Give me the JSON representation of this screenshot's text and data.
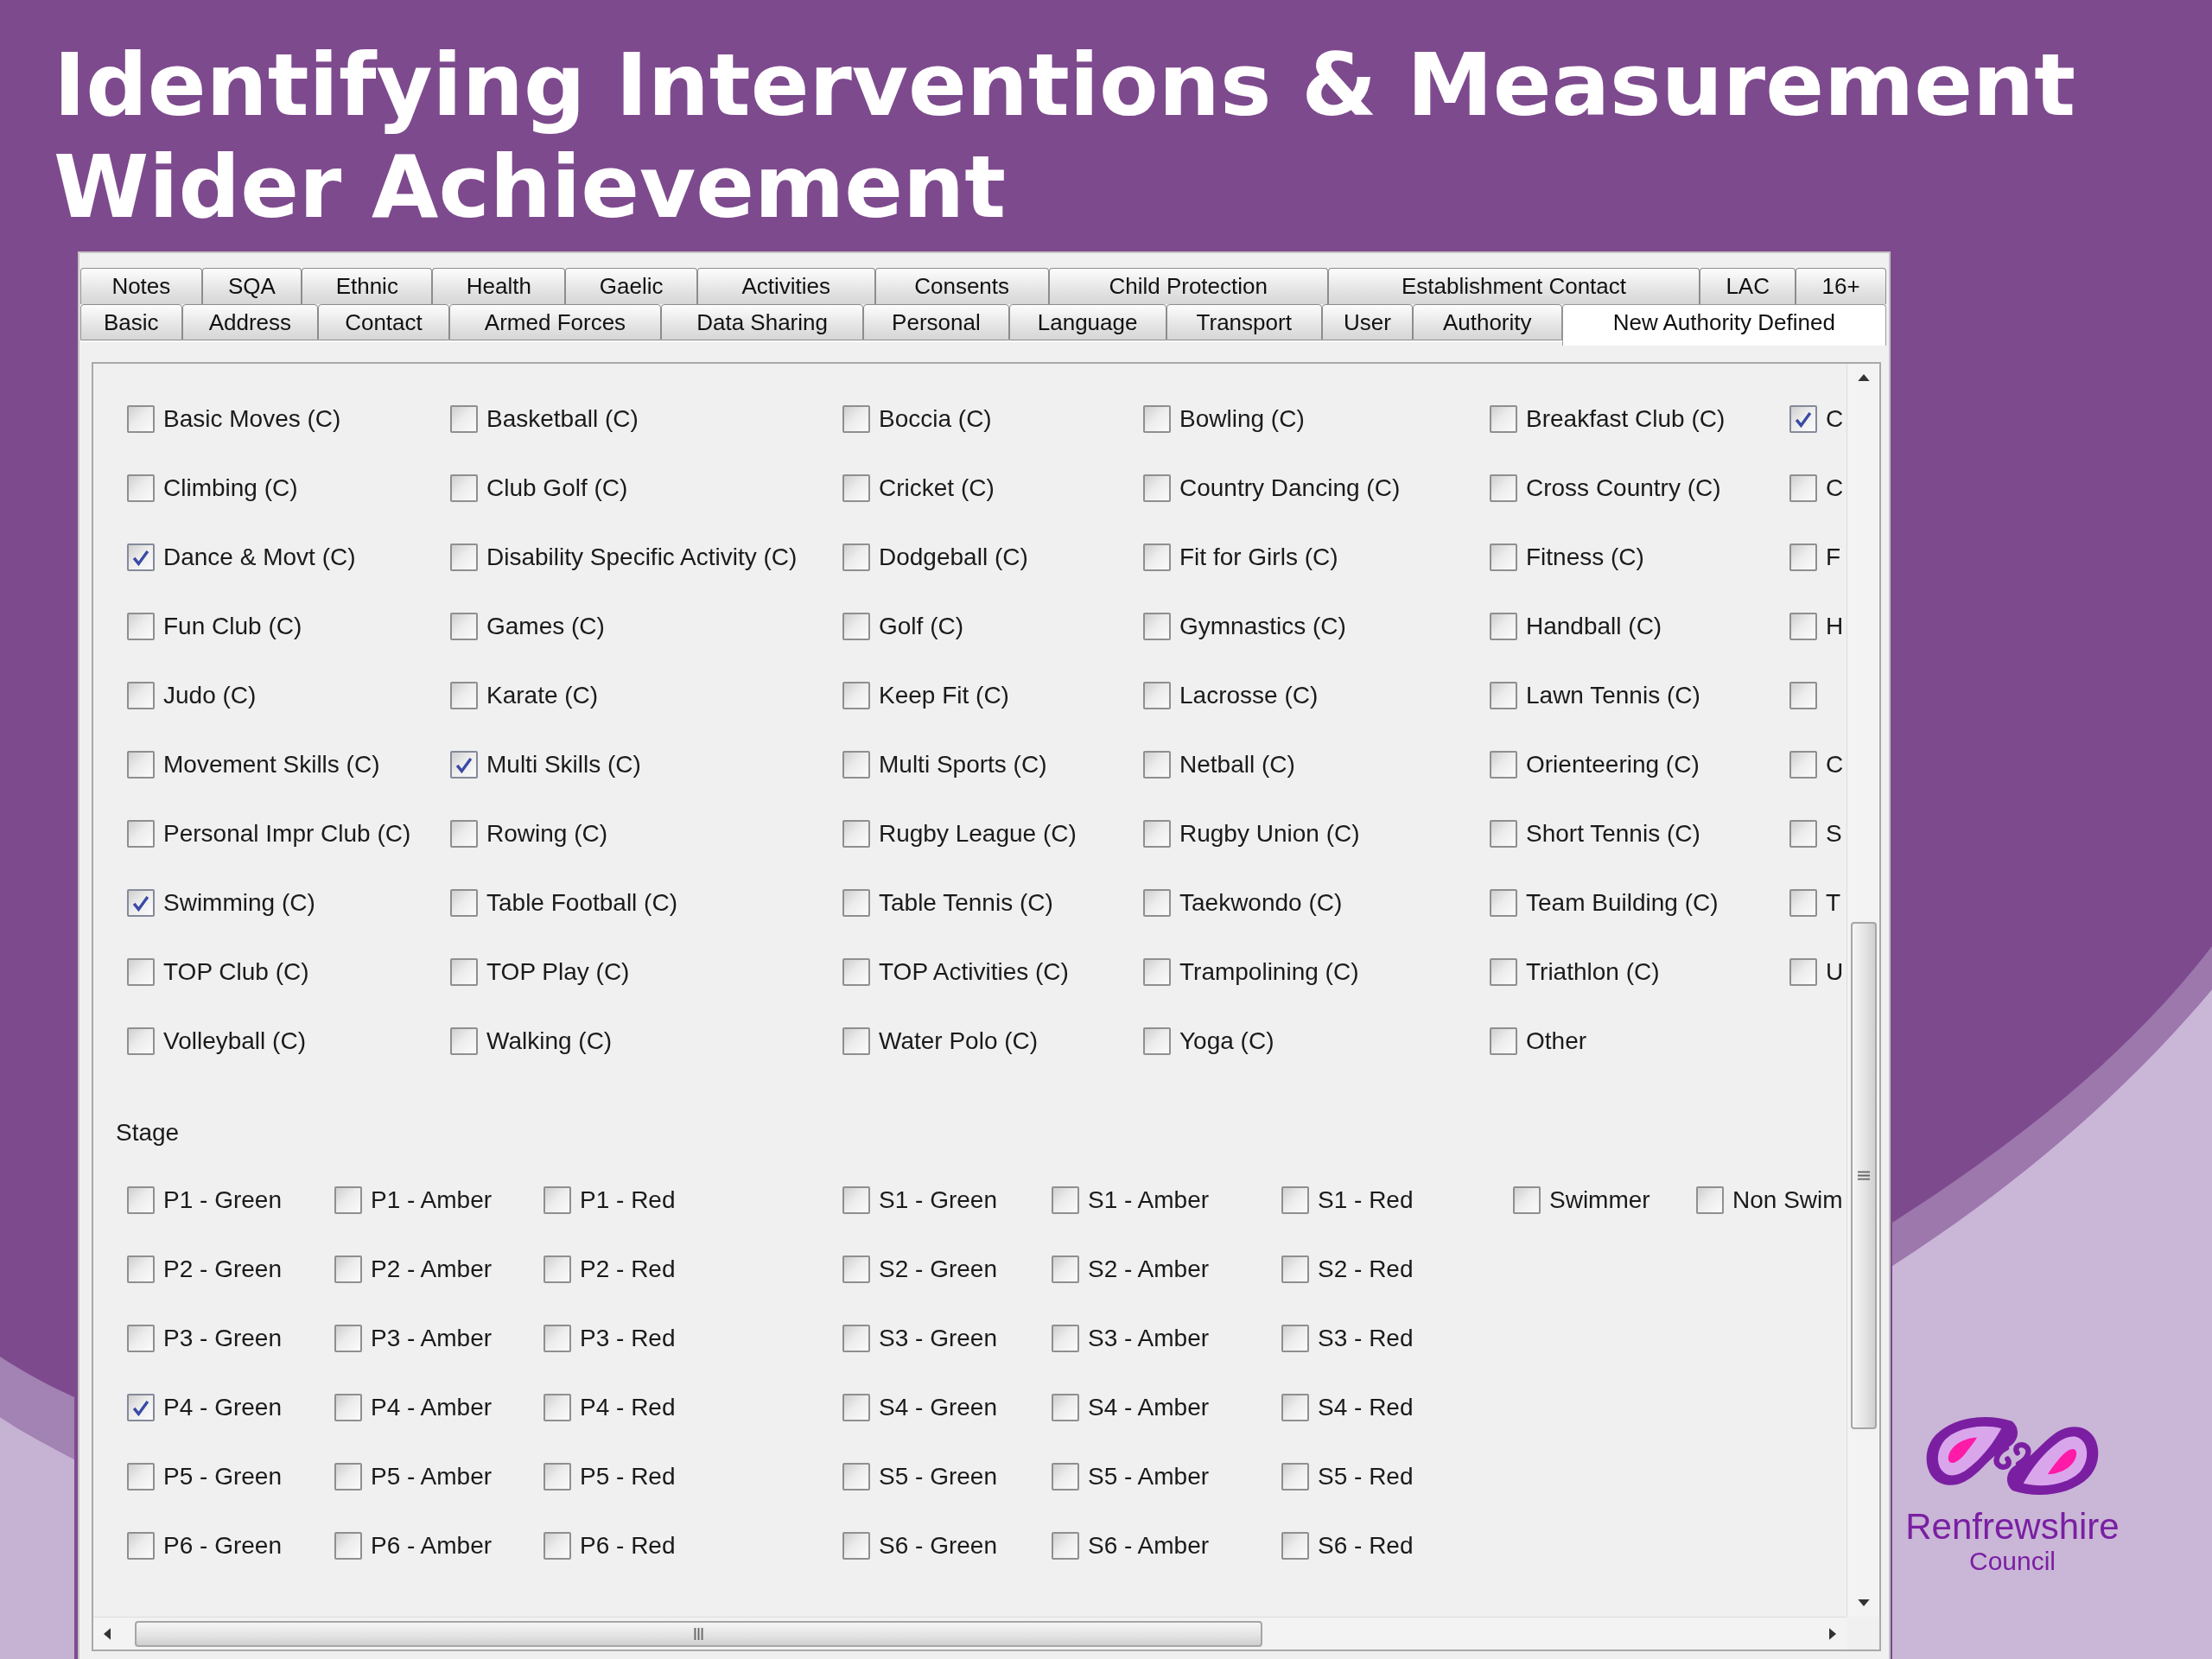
{
  "slide_title": "Identifying Interventions & Measurement Wider Achievement",
  "tab_rows": [
    [
      {
        "label": "Notes",
        "selected": false
      },
      {
        "label": "SQA",
        "selected": false
      },
      {
        "label": "Ethnic",
        "selected": false
      },
      {
        "label": "Health",
        "selected": false
      },
      {
        "label": "Gaelic",
        "selected": false
      },
      {
        "label": "Activities",
        "selected": false
      },
      {
        "label": "Consents",
        "selected": false
      },
      {
        "label": "Child Protection",
        "selected": false
      },
      {
        "label": "Establishment Contact",
        "selected": false
      },
      {
        "label": "LAC",
        "selected": false
      },
      {
        "label": "16+",
        "selected": false
      }
    ],
    [
      {
        "label": "Basic",
        "selected": false
      },
      {
        "label": "Address",
        "selected": false
      },
      {
        "label": "Contact",
        "selected": false
      },
      {
        "label": "Armed Forces",
        "selected": false
      },
      {
        "label": "Data Sharing",
        "selected": false
      },
      {
        "label": "Personal",
        "selected": false
      },
      {
        "label": "Language",
        "selected": false
      },
      {
        "label": "Transport",
        "selected": false
      },
      {
        "label": "User",
        "selected": false
      },
      {
        "label": "Authority",
        "selected": false
      },
      {
        "label": "New Authority Defined",
        "selected": true
      }
    ]
  ],
  "activities": {
    "rows": [
      [
        {
          "label": "Basic Moves (C)",
          "checked": false
        },
        {
          "label": "Basketball (C)",
          "checked": false
        },
        {
          "label": "Boccia (C)",
          "checked": false
        },
        {
          "label": "Bowling (C)",
          "checked": false
        },
        {
          "label": "Breakfast Club (C)",
          "checked": false
        },
        {
          "label": "C",
          "checked": true
        }
      ],
      [
        {
          "label": "Climbing (C)",
          "checked": false
        },
        {
          "label": "Club Golf (C)",
          "checked": false
        },
        {
          "label": "Cricket (C)",
          "checked": false
        },
        {
          "label": "Country Dancing (C)",
          "checked": false
        },
        {
          "label": "Cross Country (C)",
          "checked": false
        },
        {
          "label": "C",
          "checked": false
        }
      ],
      [
        {
          "label": "Dance & Movt (C)",
          "checked": true
        },
        {
          "label": "Disability Specific Activity (C)",
          "checked": false
        },
        {
          "label": "Dodgeball (C)",
          "checked": false
        },
        {
          "label": "Fit for Girls (C)",
          "checked": false
        },
        {
          "label": "Fitness (C)",
          "checked": false
        },
        {
          "label": "F",
          "checked": false
        }
      ],
      [
        {
          "label": "Fun Club (C)",
          "checked": false
        },
        {
          "label": "Games (C)",
          "checked": false
        },
        {
          "label": "Golf (C)",
          "checked": false
        },
        {
          "label": "Gymnastics (C)",
          "checked": false
        },
        {
          "label": "Handball (C)",
          "checked": false
        },
        {
          "label": "H",
          "checked": false
        }
      ],
      [
        {
          "label": "Judo (C)",
          "checked": false
        },
        {
          "label": "Karate (C)",
          "checked": false
        },
        {
          "label": "Keep Fit (C)",
          "checked": false
        },
        {
          "label": "Lacrosse (C)",
          "checked": false
        },
        {
          "label": "Lawn Tennis (C)",
          "checked": false
        },
        {
          "checked": false
        }
      ],
      [
        {
          "label": "Movement Skills (C)",
          "checked": false
        },
        {
          "label": "Multi Skills (C)",
          "checked": true
        },
        {
          "label": "Multi Sports (C)",
          "checked": false
        },
        {
          "label": "Netball (C)",
          "checked": false
        },
        {
          "label": "Orienteering (C)",
          "checked": false
        },
        {
          "label": "C",
          "checked": false
        }
      ],
      [
        {
          "label": "Personal Impr Club (C)",
          "checked": false
        },
        {
          "label": "Rowing (C)",
          "checked": false
        },
        {
          "label": "Rugby League (C)",
          "checked": false
        },
        {
          "label": "Rugby Union (C)",
          "checked": false
        },
        {
          "label": "Short Tennis (C)",
          "checked": false
        },
        {
          "label": "S",
          "checked": false
        }
      ],
      [
        {
          "label": "Swimming (C)",
          "checked": true
        },
        {
          "label": "Table Football (C)",
          "checked": false
        },
        {
          "label": "Table Tennis (C)",
          "checked": false
        },
        {
          "label": "Taekwondo (C)",
          "checked": false
        },
        {
          "label": "Team Building (C)",
          "checked": false
        },
        {
          "label": "T",
          "checked": false
        }
      ],
      [
        {
          "label": "TOP Club (C)",
          "checked": false
        },
        {
          "label": "TOP Play (C)",
          "checked": false
        },
        {
          "label": "TOP Activities (C)",
          "checked": false
        },
        {
          "label": "Trampolining (C)",
          "checked": false
        },
        {
          "label": "Triathlon (C)",
          "checked": false
        },
        {
          "label": "U",
          "checked": false
        }
      ],
      [
        {
          "label": "Volleyball (C)",
          "checked": false
        },
        {
          "label": "Walking (C)",
          "checked": false
        },
        {
          "label": "Water Polo (C)",
          "checked": false
        },
        {
          "label": "Yoga (C)",
          "checked": false
        },
        {
          "label": "Other",
          "checked": false
        }
      ]
    ]
  },
  "stage": {
    "label": "Stage",
    "rows": [
      [
        {
          "label": "P1 - Green",
          "checked": false
        },
        {
          "label": "P1 - Amber",
          "checked": false
        },
        {
          "label": "P1 - Red",
          "checked": false
        },
        {
          "label": "S1 - Green",
          "checked": false
        },
        {
          "label": "S1 - Amber",
          "checked": false
        },
        {
          "label": "S1 - Red",
          "checked": false
        },
        {
          "label": "Swimmer",
          "checked": false
        },
        {
          "label": "Non Swim",
          "checked": false
        }
      ],
      [
        {
          "label": "P2 - Green",
          "checked": false
        },
        {
          "label": "P2 - Amber",
          "checked": false
        },
        {
          "label": "P2 - Red",
          "checked": false
        },
        {
          "label": "S2 - Green",
          "checked": false
        },
        {
          "label": "S2 - Amber",
          "checked": false
        },
        {
          "label": "S2 - Red",
          "checked": false
        }
      ],
      [
        {
          "label": "P3 - Green",
          "checked": false
        },
        {
          "label": "P3 - Amber",
          "checked": false
        },
        {
          "label": "P3 - Red",
          "checked": false
        },
        {
          "label": "S3 - Green",
          "checked": false
        },
        {
          "label": "S3 - Amber",
          "checked": false
        },
        {
          "label": "S3 - Red",
          "checked": false
        }
      ],
      [
        {
          "label": "P4 - Green",
          "checked": true
        },
        {
          "label": "P4 - Amber",
          "checked": false
        },
        {
          "label": "P4 - Red",
          "checked": false
        },
        {
          "label": "S4 - Green",
          "checked": false
        },
        {
          "label": "S4 - Amber",
          "checked": false
        },
        {
          "label": "S4 - Red",
          "checked": false
        }
      ],
      [
        {
          "label": "P5 - Green",
          "checked": false
        },
        {
          "label": "P5 - Amber",
          "checked": false
        },
        {
          "label": "P5 - Red",
          "checked": false
        },
        {
          "label": "S5 - Green",
          "checked": false
        },
        {
          "label": "S5 - Amber",
          "checked": false
        },
        {
          "label": "S5 - Red",
          "checked": false
        }
      ],
      [
        {
          "label": "P6 - Green",
          "checked": false
        },
        {
          "label": "P6 - Amber",
          "checked": false
        },
        {
          "label": "P6 - Red",
          "checked": false
        },
        {
          "label": "S6 - Green",
          "checked": false
        },
        {
          "label": "S6 - Amber",
          "checked": false
        },
        {
          "label": "S6 - Red",
          "checked": false
        }
      ]
    ]
  },
  "logo": {
    "name": "Renfrewshire",
    "subtitle": "Council"
  }
}
